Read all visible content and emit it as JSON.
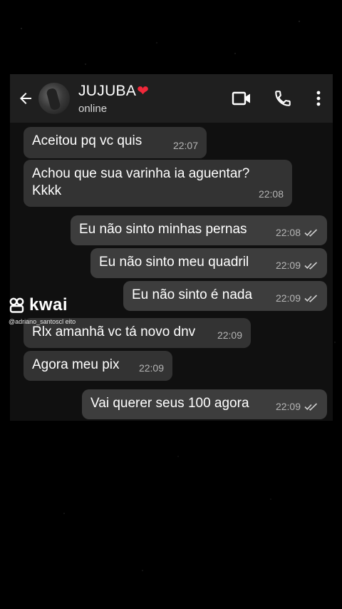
{
  "header": {
    "back_icon": "arrow-left-icon",
    "contact_name": "JUJUBA",
    "contact_emoji": "❤",
    "status": "online",
    "video_icon": "videocam-icon",
    "call_icon": "phone-icon",
    "menu_icon": "more-vert-icon"
  },
  "messages": [
    {
      "direction": "incoming",
      "text": "Aceitou pq vc quis",
      "time": "22:07"
    },
    {
      "direction": "incoming",
      "text": "Achou que sua varinha ia aguentar?\nKkkk",
      "time": "22:08"
    },
    {
      "direction": "outgoing",
      "text": "Eu não sinto minhas pernas",
      "time": "22:08",
      "status": "read"
    },
    {
      "direction": "outgoing",
      "text": "Eu não sinto meu quadril",
      "time": "22:09",
      "status": "read"
    },
    {
      "direction": "outgoing",
      "text": "Eu não sinto é nada",
      "time": "22:09",
      "status": "read"
    },
    {
      "direction": "incoming",
      "text": "Rlx amanhã vc tá novo dnv",
      "time": "22:09"
    },
    {
      "direction": "incoming",
      "text": "Agora meu pix",
      "time": "22:09"
    },
    {
      "direction": "outgoing",
      "text": "Vai querer seus 100 agora",
      "time": "22:09",
      "status": "read"
    }
  ],
  "watermark": {
    "brand": "kwai",
    "handle": "@adriano_santoscl eito"
  },
  "colors": {
    "header_bg": "#1f1f1f",
    "chat_bg": "#101010",
    "bubble": "#3a3a3a",
    "heart": "#f0283a"
  }
}
